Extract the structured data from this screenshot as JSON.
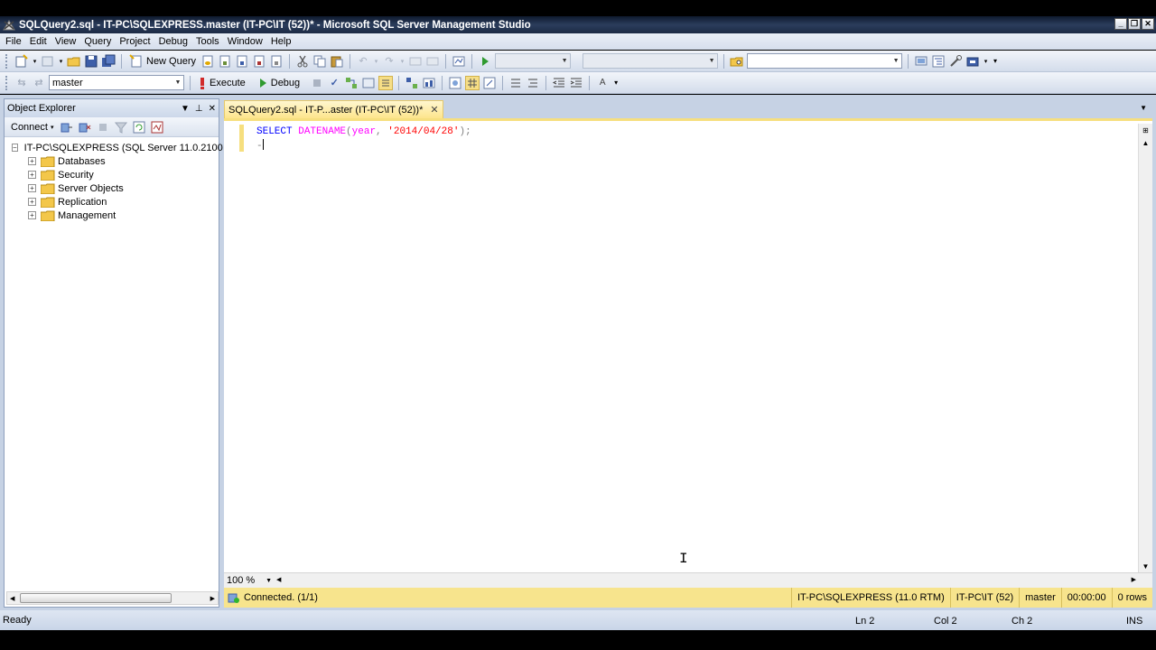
{
  "window": {
    "title": "SQLQuery2.sql - IT-PC\\SQLEXPRESS.master (IT-PC\\IT (52))* - Microsoft SQL Server Management Studio",
    "controls": {
      "minimize": "_",
      "restore": "❐",
      "close": "✕"
    }
  },
  "menu": [
    "File",
    "Edit",
    "View",
    "Query",
    "Project",
    "Debug",
    "Tools",
    "Window",
    "Help"
  ],
  "toolbar1": {
    "new_query_label": "New Query",
    "search_value": ""
  },
  "toolbar2": {
    "database_value": "master",
    "execute_label": "Execute",
    "debug_label": "Debug"
  },
  "object_explorer": {
    "title": "Object Explorer",
    "connect_label": "Connect",
    "server_node": "IT-PC\\SQLEXPRESS (SQL Server 11.0.2100",
    "folders": [
      "Databases",
      "Security",
      "Server Objects",
      "Replication",
      "Management"
    ]
  },
  "editor": {
    "tab_label": "SQLQuery2.sql - IT-P...aster (IT-PC\\IT (52))*",
    "code": {
      "select": "SELECT",
      "func": "DATENAME",
      "open": "(",
      "arg1": "year",
      "comma": ", ",
      "arg2": "'2014/04/28'",
      "close": ");",
      "line2_prefix": "-"
    },
    "zoom": "100 %"
  },
  "query_status": {
    "connected": "Connected. (1/1)",
    "server": "IT-PC\\SQLEXPRESS (11.0 RTM)",
    "user": "IT-PC\\IT (52)",
    "database": "master",
    "elapsed": "00:00:00",
    "rows": "0 rows"
  },
  "statusbar": {
    "ready": "Ready",
    "ln": "Ln 2",
    "col": "Col 2",
    "ch": "Ch 2",
    "ins": "INS"
  },
  "colors": {
    "tab_yellow": "#fde58c",
    "status_yellow": "#f7e48d",
    "chrome_blue": "#c6d2e4",
    "keyword": "#0000ff",
    "function": "#ff00ff",
    "string": "#ff0000"
  }
}
